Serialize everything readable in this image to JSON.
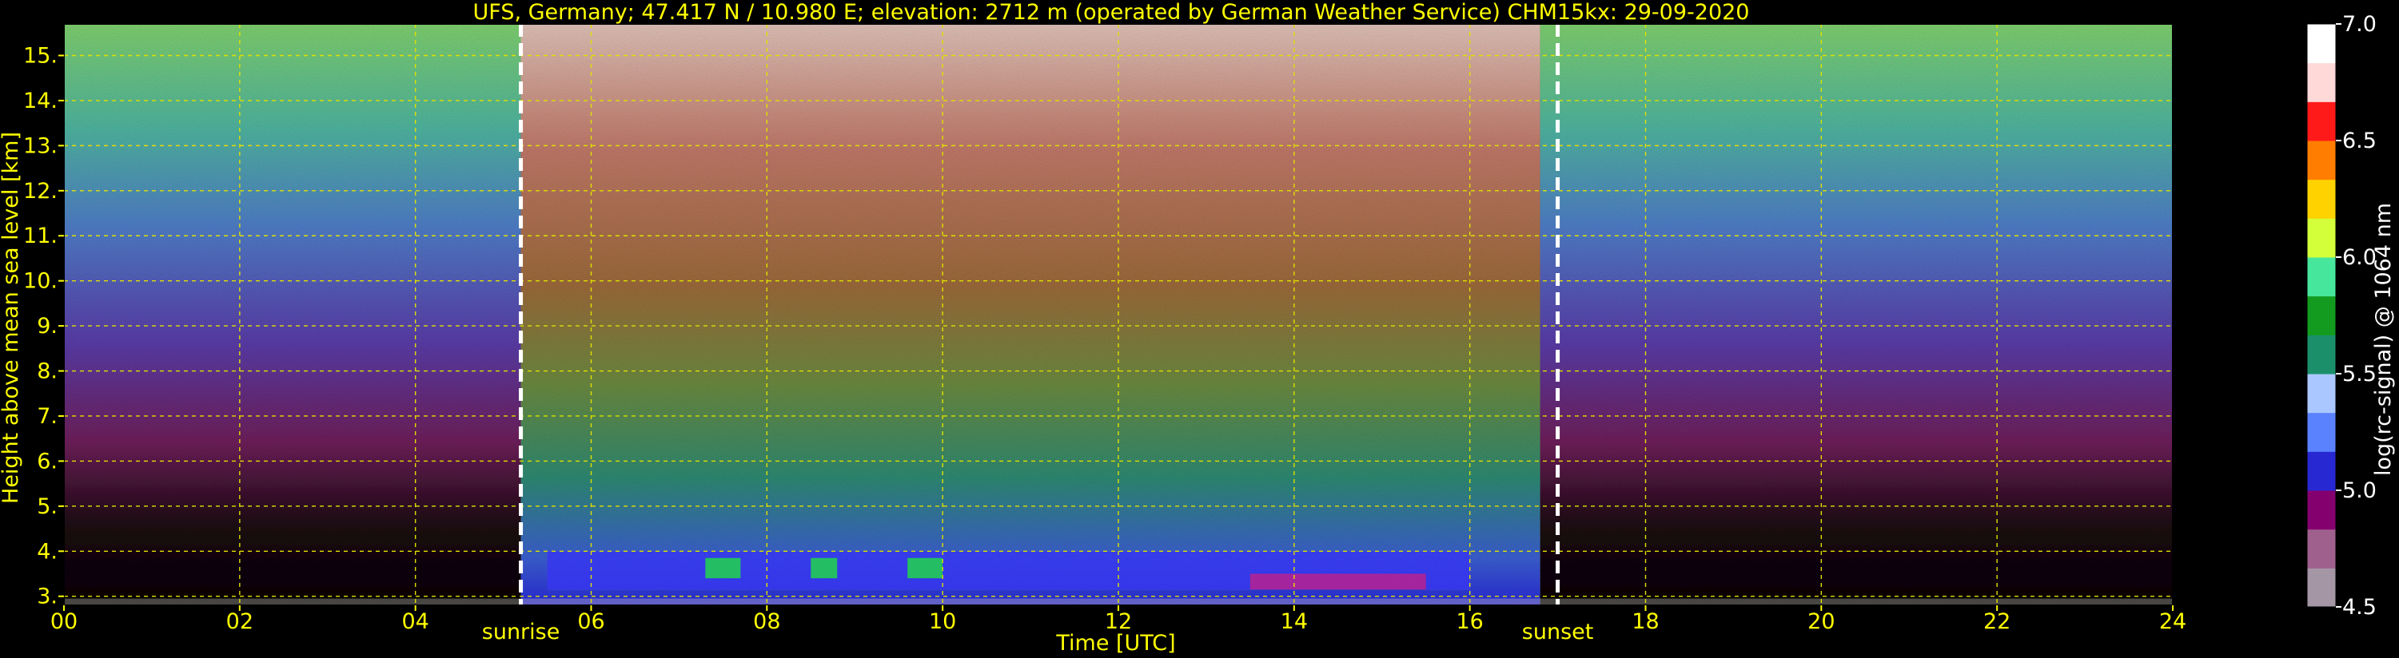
{
  "chart_data": {
    "type": "heatmap",
    "title": "UFS, Germany; 47.417 N / 10.980 E; elevation: 2712 m  (operated by German Weather Service)    CHM15kx: 29-09-2020",
    "xlabel": "Time [UTC]",
    "ylabel": "Height above mean sea level [km]",
    "xlim": [
      0,
      24
    ],
    "ylim": [
      2.8,
      15.7
    ],
    "x_ticks": [
      "00",
      "02",
      "04",
      "06",
      "08",
      "10",
      "12",
      "14",
      "16",
      "18",
      "20",
      "22",
      "24"
    ],
    "y_ticks": [
      "3.",
      "4.",
      "5.",
      "6.",
      "7.",
      "8.",
      "9.",
      "10.",
      "11.",
      "12.",
      "13.",
      "14.",
      "15."
    ],
    "grid": true,
    "annotations": [
      {
        "label": "sunrise",
        "x": 5.2
      },
      {
        "label": "sunset",
        "x": 17.0
      }
    ],
    "colorbar": {
      "label": "log(rc-signal) @ 1064 nm",
      "min": 4.5,
      "max": 7.0,
      "ticks": [
        "4.5",
        "5.0",
        "5.5",
        "6.0",
        "6.5",
        "7.0"
      ],
      "colors": [
        "#a596a6",
        "#a0608e",
        "#84006f",
        "#2828d2",
        "#5a82ff",
        "#aac8ff",
        "#1a8f6a",
        "#129b1e",
        "#46e69c",
        "#d2ff3a",
        "#ffd200",
        "#ff7d00",
        "#ff1a1a",
        "#ffd8d8",
        "#ffffff"
      ]
    },
    "signal_zones": [
      {
        "from": 0,
        "to": 5.2,
        "description_color": "#6464c8"
      },
      {
        "from": 5.2,
        "to": 16.8,
        "description_color": "#c87850"
      },
      {
        "from": 16.8,
        "to": 24,
        "description_color": "#6464c8"
      }
    ],
    "boundary_layer_top_km": 4.0
  }
}
